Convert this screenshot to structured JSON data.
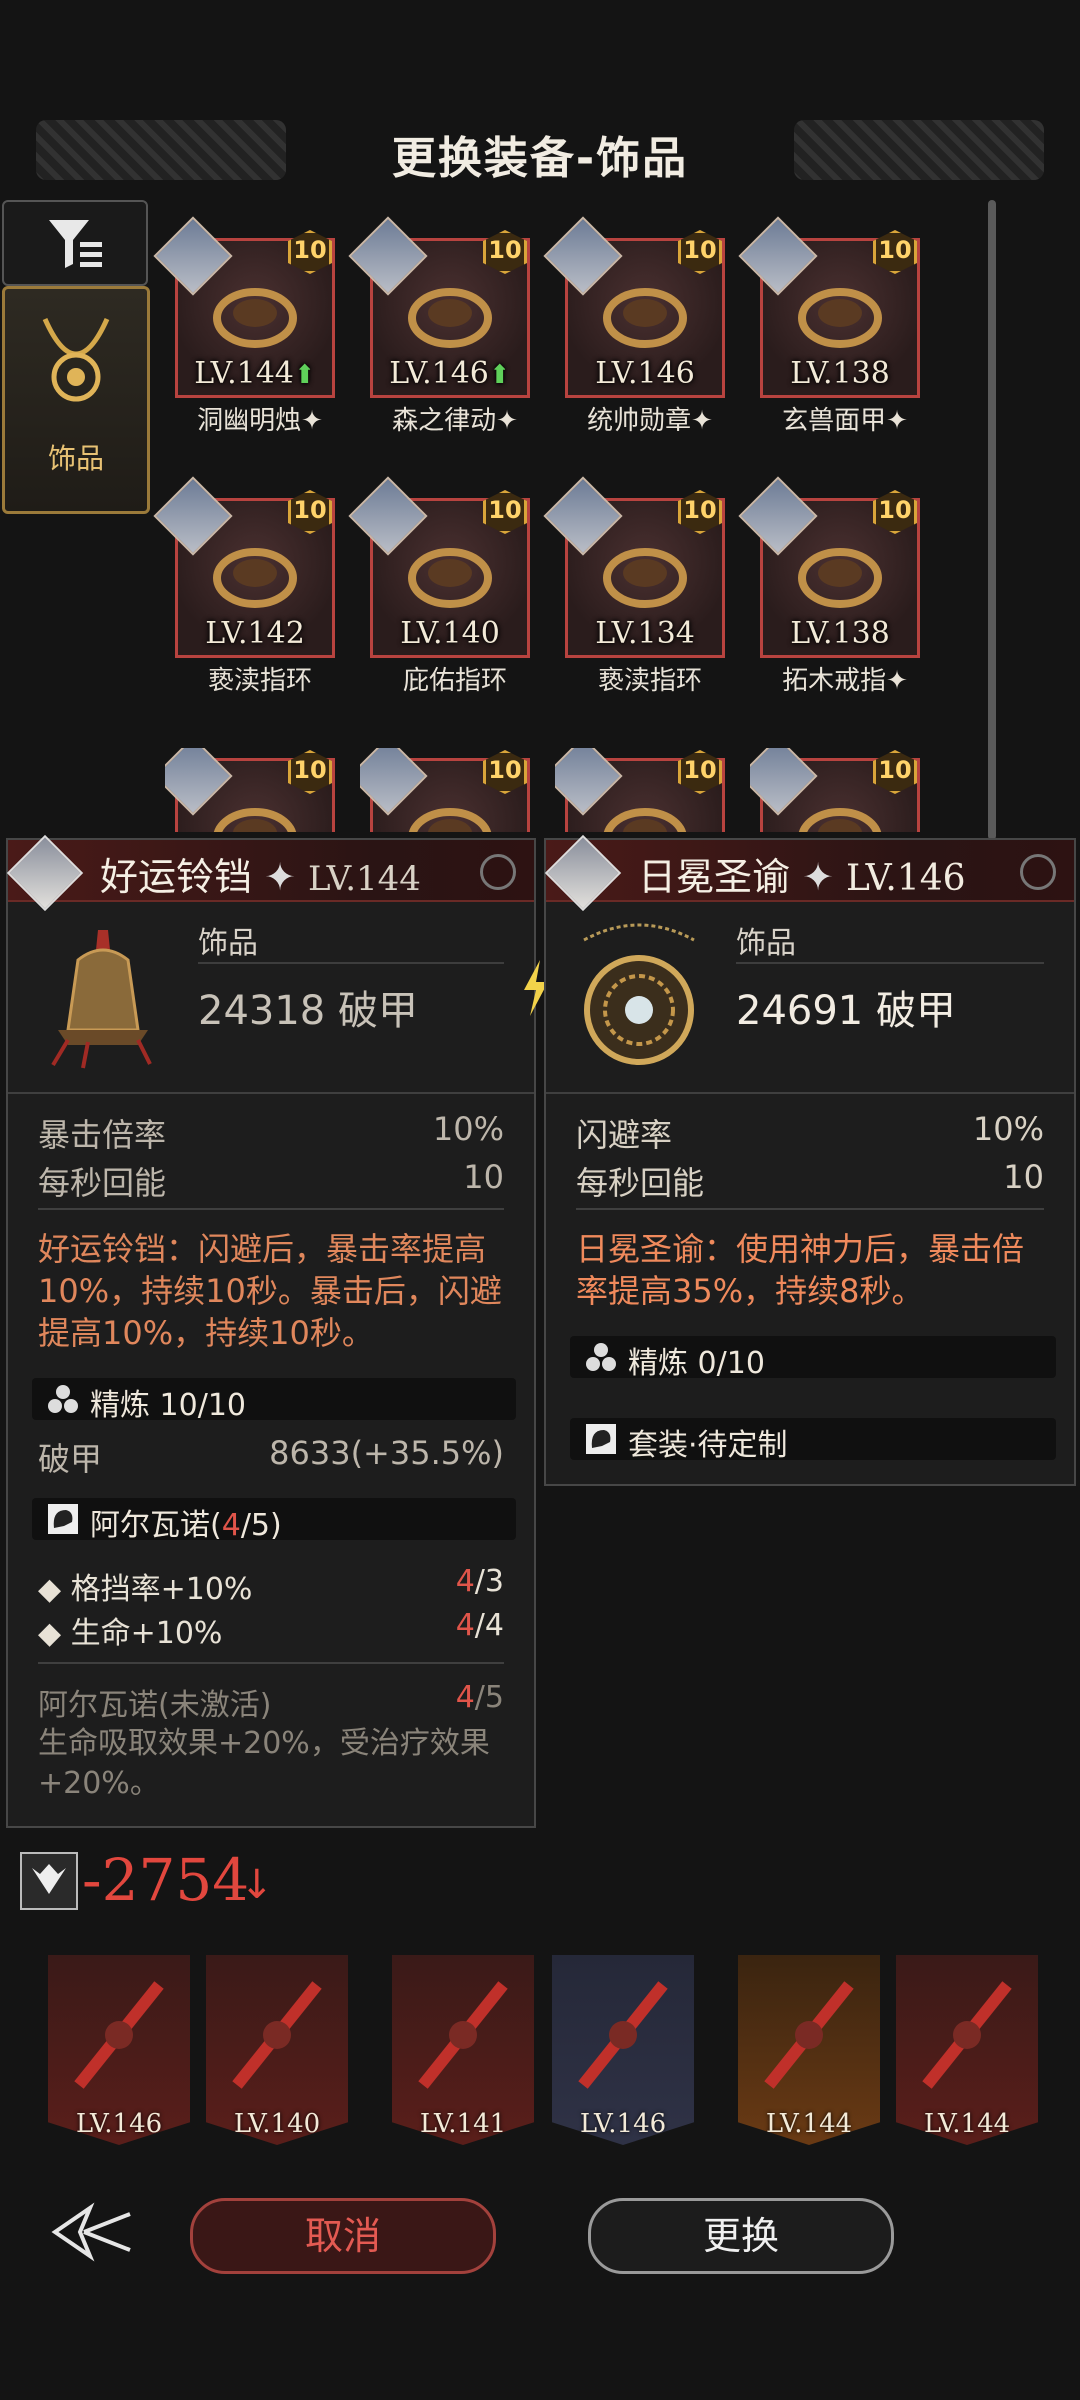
{
  "header": {
    "title": "更换装备-饰品"
  },
  "category": {
    "label": "饰品"
  },
  "grid": {
    "items": [
      {
        "level": "LV.144",
        "up": true,
        "name": "洞幽明烛",
        "star": true,
        "badge": "10"
      },
      {
        "level": "LV.146",
        "up": true,
        "name": "森之律动",
        "star": true,
        "badge": "10"
      },
      {
        "level": "LV.146",
        "up": false,
        "name": "统帅勋章",
        "star": true,
        "badge": "10"
      },
      {
        "level": "LV.138",
        "up": false,
        "name": "玄兽面甲",
        "star": true,
        "badge": "10"
      },
      {
        "level": "LV.142",
        "up": false,
        "name": "亵渎指环",
        "star": false,
        "badge": "10"
      },
      {
        "level": "LV.140",
        "up": false,
        "name": "庇佑指环",
        "star": false,
        "badge": "10"
      },
      {
        "level": "LV.134",
        "up": false,
        "name": "亵渎指环",
        "star": false,
        "badge": "10"
      },
      {
        "level": "LV.138",
        "up": false,
        "name": "拓木戒指",
        "star": true,
        "badge": "10"
      },
      {
        "level": "",
        "up": false,
        "name": "",
        "star": false,
        "badge": "10"
      },
      {
        "level": "",
        "up": false,
        "name": "",
        "star": false,
        "badge": "10"
      },
      {
        "level": "",
        "up": false,
        "name": "",
        "star": false,
        "badge": "10"
      },
      {
        "level": "",
        "up": false,
        "name": "",
        "star": false,
        "badge": "10"
      }
    ]
  },
  "current": {
    "name": "好运铃铛",
    "level": "LV.144",
    "type": "饰品",
    "main_stat": "24318 破甲",
    "stats": [
      {
        "label": "暴击倍率",
        "value": "10%"
      },
      {
        "label": "每秒回能",
        "value": "10"
      }
    ],
    "desc": "好运铃铛：闪避后，暴击率提高10%，持续10秒。暴击后，闪避提高10%，持续10秒。",
    "refine": "精炼 10/10",
    "refine_stat": {
      "label": "破甲",
      "value": "8633(+35.5%)"
    },
    "set": {
      "name": "阿尔瓦诺(",
      "count": "4",
      "total": "/5)"
    },
    "set_bonuses": [
      {
        "label": "格挡率+10%",
        "cur": "4",
        "req": "/3"
      },
      {
        "label": "生命+10%",
        "cur": "4",
        "req": "/4"
      }
    ],
    "inactive": {
      "label": "阿尔瓦诺(未激活)",
      "cur": "4",
      "req": "/5",
      "desc": "生命吸取效果+20%，受治疗效果+20%。"
    }
  },
  "candidate": {
    "name": "日冕圣谕",
    "level": "LV.146",
    "type": "饰品",
    "main_stat": "24691 破甲",
    "stats": [
      {
        "label": "闪避率",
        "value": "10%"
      },
      {
        "label": "每秒回能",
        "value": "10"
      }
    ],
    "desc": "日冕圣谕：使用神力后，暴击倍率提高35%，持续8秒。",
    "refine": "精炼 0/10",
    "set": "套装·待定制"
  },
  "score": {
    "value": "-2754",
    "color": "#e2473e"
  },
  "equipped": [
    {
      "level": "LV.146"
    },
    {
      "level": "LV.140"
    },
    {
      "level": "LV.141"
    },
    {
      "level": "LV.146"
    },
    {
      "level": "LV.144"
    },
    {
      "level": "LV.144"
    }
  ],
  "buttons": {
    "cancel": "取消",
    "swap": "更换"
  }
}
